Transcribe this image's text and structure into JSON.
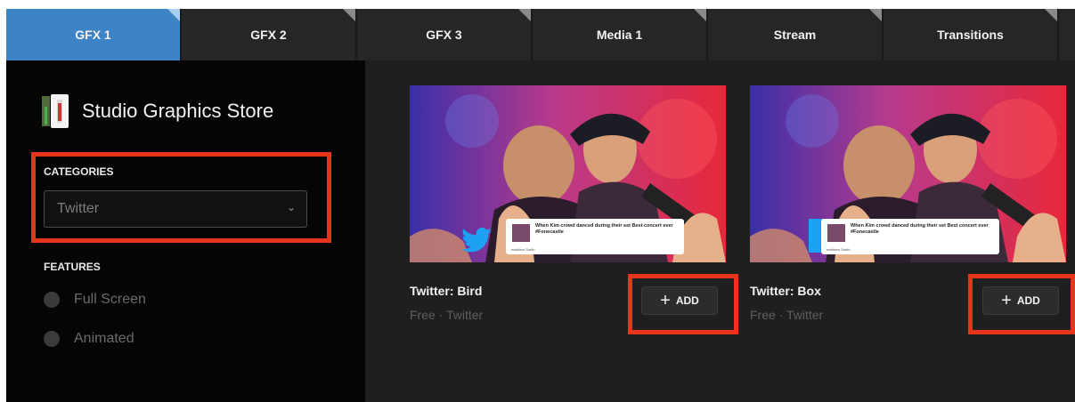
{
  "tabs": [
    "GFX 1",
    "GFX 2",
    "GFX 3",
    "Media 1",
    "Stream",
    "Transitions"
  ],
  "sidebar": {
    "store_title": "Studio Graphics Store",
    "categories_label": "CATEGORIES",
    "category_selected": "Twitter",
    "features_label": "FEATURES",
    "features": [
      "Full Screen",
      "Animated"
    ]
  },
  "cards": [
    {
      "title": "Twitter: Bird",
      "subtitle": "Free · Twitter",
      "add_label": "ADD",
      "tweet_text": "When Kim crowd danced during their set Best concert ever #Fonecastle",
      "tweet_handle": "matthew Smith"
    },
    {
      "title": "Twitter: Box",
      "subtitle": "Free · Twitter",
      "add_label": "ADD",
      "tweet_text": "When Kim crowd danced during their set Best concert ever #Fonecastle",
      "tweet_handle": "matthew Smith"
    }
  ],
  "colors": {
    "active_tab": "#3d84c6",
    "highlight": "#e8341b",
    "twitter_blue": "#1da1f2"
  },
  "icons": {
    "dropdown": "chevron-down-icon",
    "add": "plus-icon",
    "twitter": "twitter-bird-icon",
    "store": "store-logo-icon"
  }
}
